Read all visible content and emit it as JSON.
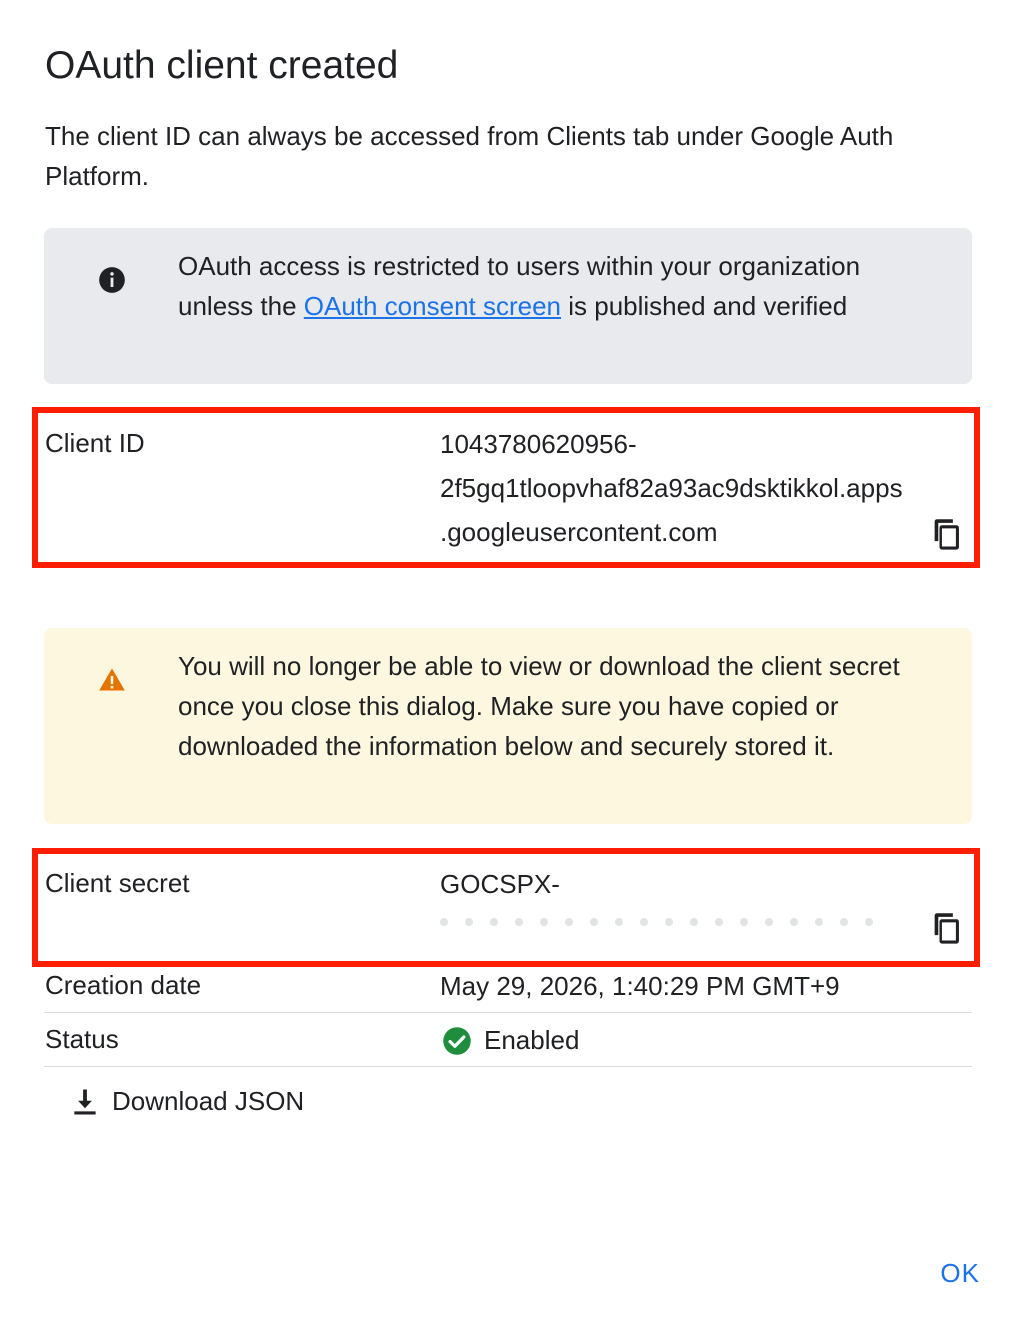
{
  "dialog": {
    "title": "OAuth client created",
    "description": "The client ID can always be accessed from Clients tab under Google Auth Platform."
  },
  "info_banner": {
    "icon": "info-icon",
    "text_before": "OAuth access is restricted to users within your organization unless the ",
    "link_text": "OAuth consent screen",
    "text_after": " is published and verified"
  },
  "client_id": {
    "label": "Client ID",
    "line1": "1043780620956-",
    "line2": "2f5gq1tloopvhaf82a93ac9dsktikkol.apps",
    "line3": ".googleusercontent.com",
    "copy_icon": "copy-icon"
  },
  "warning_banner": {
    "icon": "warning-icon",
    "text": "You will no longer be able to view or download the client secret once you close this dialog. Make sure you have copied or downloaded the information below and securely stored it."
  },
  "client_secret": {
    "label": "Client secret",
    "value": "GOCSPX-",
    "copy_icon": "copy-icon"
  },
  "creation_date": {
    "label": "Creation date",
    "value": "May 29, 2026, 1:40:29 PM GMT+9"
  },
  "status": {
    "label": "Status",
    "value": "Enabled",
    "icon": "check-circle-icon"
  },
  "actions": {
    "download_label": "Download JSON",
    "ok_label": "OK"
  },
  "colors": {
    "accent": "#1a73e8",
    "highlight_border": "#ff1f00",
    "warning_icon": "#e37400",
    "success": "#1e8e3e"
  }
}
